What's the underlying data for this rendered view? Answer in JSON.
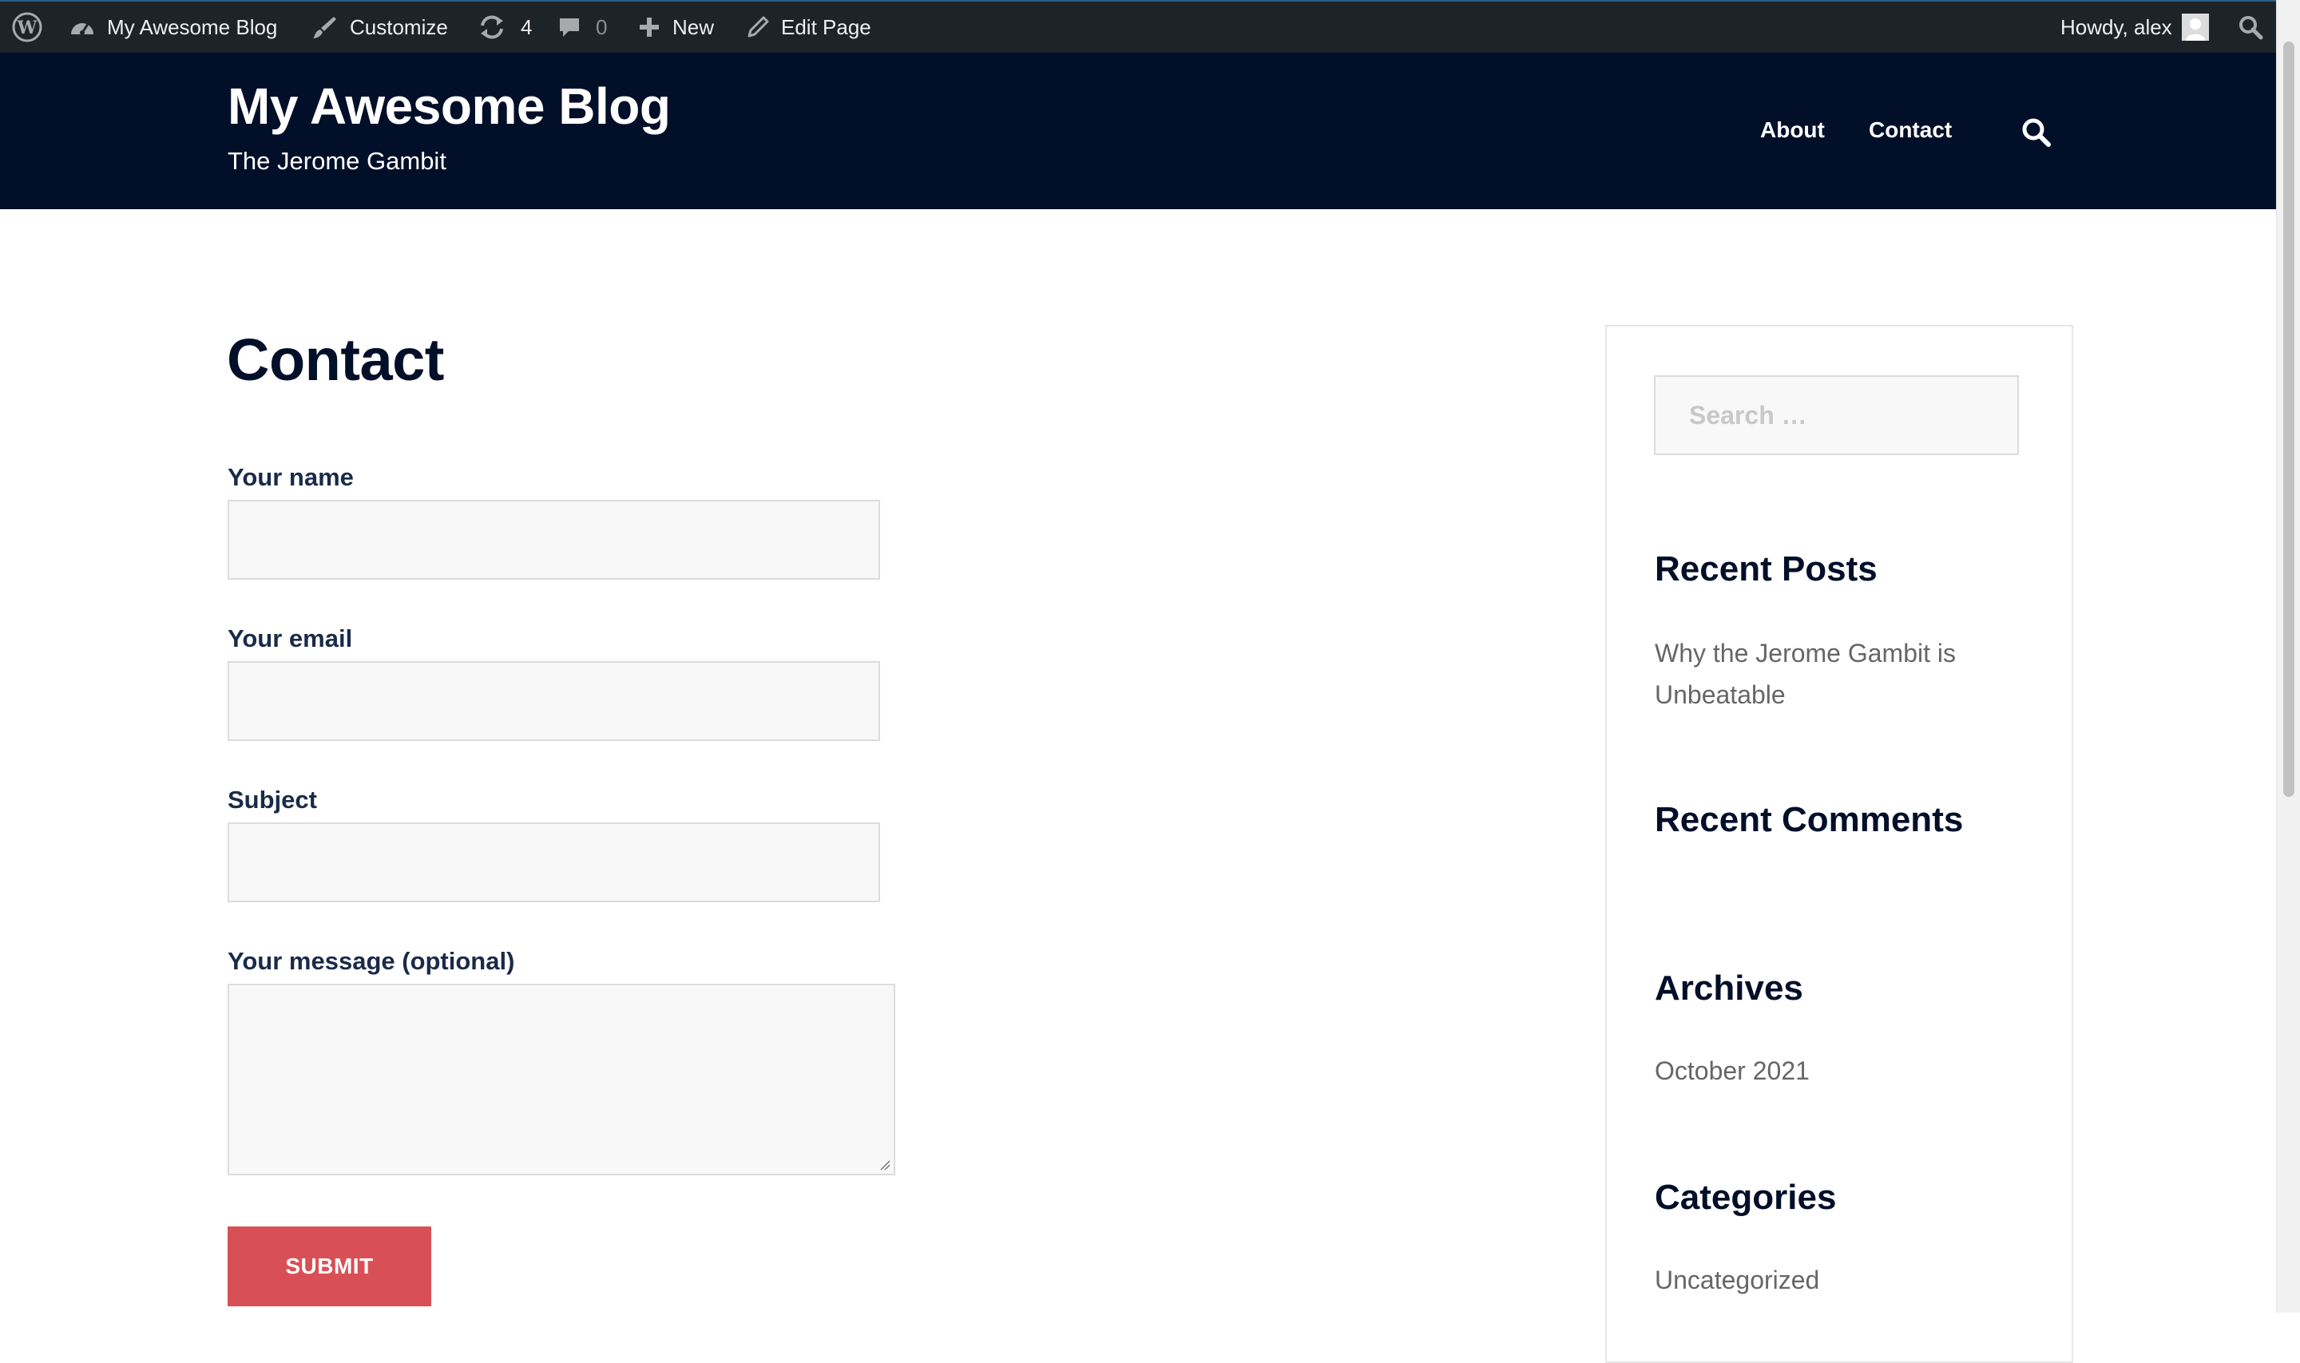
{
  "admin_bar": {
    "site_name": "My Awesome Blog",
    "customize": "Customize",
    "updates_count": "4",
    "comments_count": "0",
    "new": "New",
    "edit_page": "Edit Page",
    "howdy": "Howdy, alex"
  },
  "header": {
    "site_title": "My Awesome Blog",
    "tagline": "The Jerome Gambit",
    "nav": [
      "About",
      "Contact"
    ]
  },
  "main": {
    "title": "Contact",
    "form": {
      "fields": [
        {
          "label": "Your name",
          "value": ""
        },
        {
          "label": "Your email",
          "value": ""
        },
        {
          "label": "Subject",
          "value": ""
        }
      ],
      "message_label": "Your message (optional)",
      "submit": "SUBMIT"
    }
  },
  "sidebar": {
    "search_placeholder": "Search …",
    "recent_posts": {
      "title": "Recent Posts",
      "items": [
        "Why the Jerome Gambit is Unbeatable"
      ]
    },
    "recent_comments": {
      "title": "Recent Comments"
    },
    "archives": {
      "title": "Archives",
      "items": [
        "October 2021"
      ]
    },
    "categories": {
      "title": "Categories",
      "items": [
        "Uncategorized"
      ]
    }
  },
  "colors": {
    "admin_bar": "#1d2327",
    "header_bg": "#020f29",
    "submit_bg": "#d85055"
  }
}
